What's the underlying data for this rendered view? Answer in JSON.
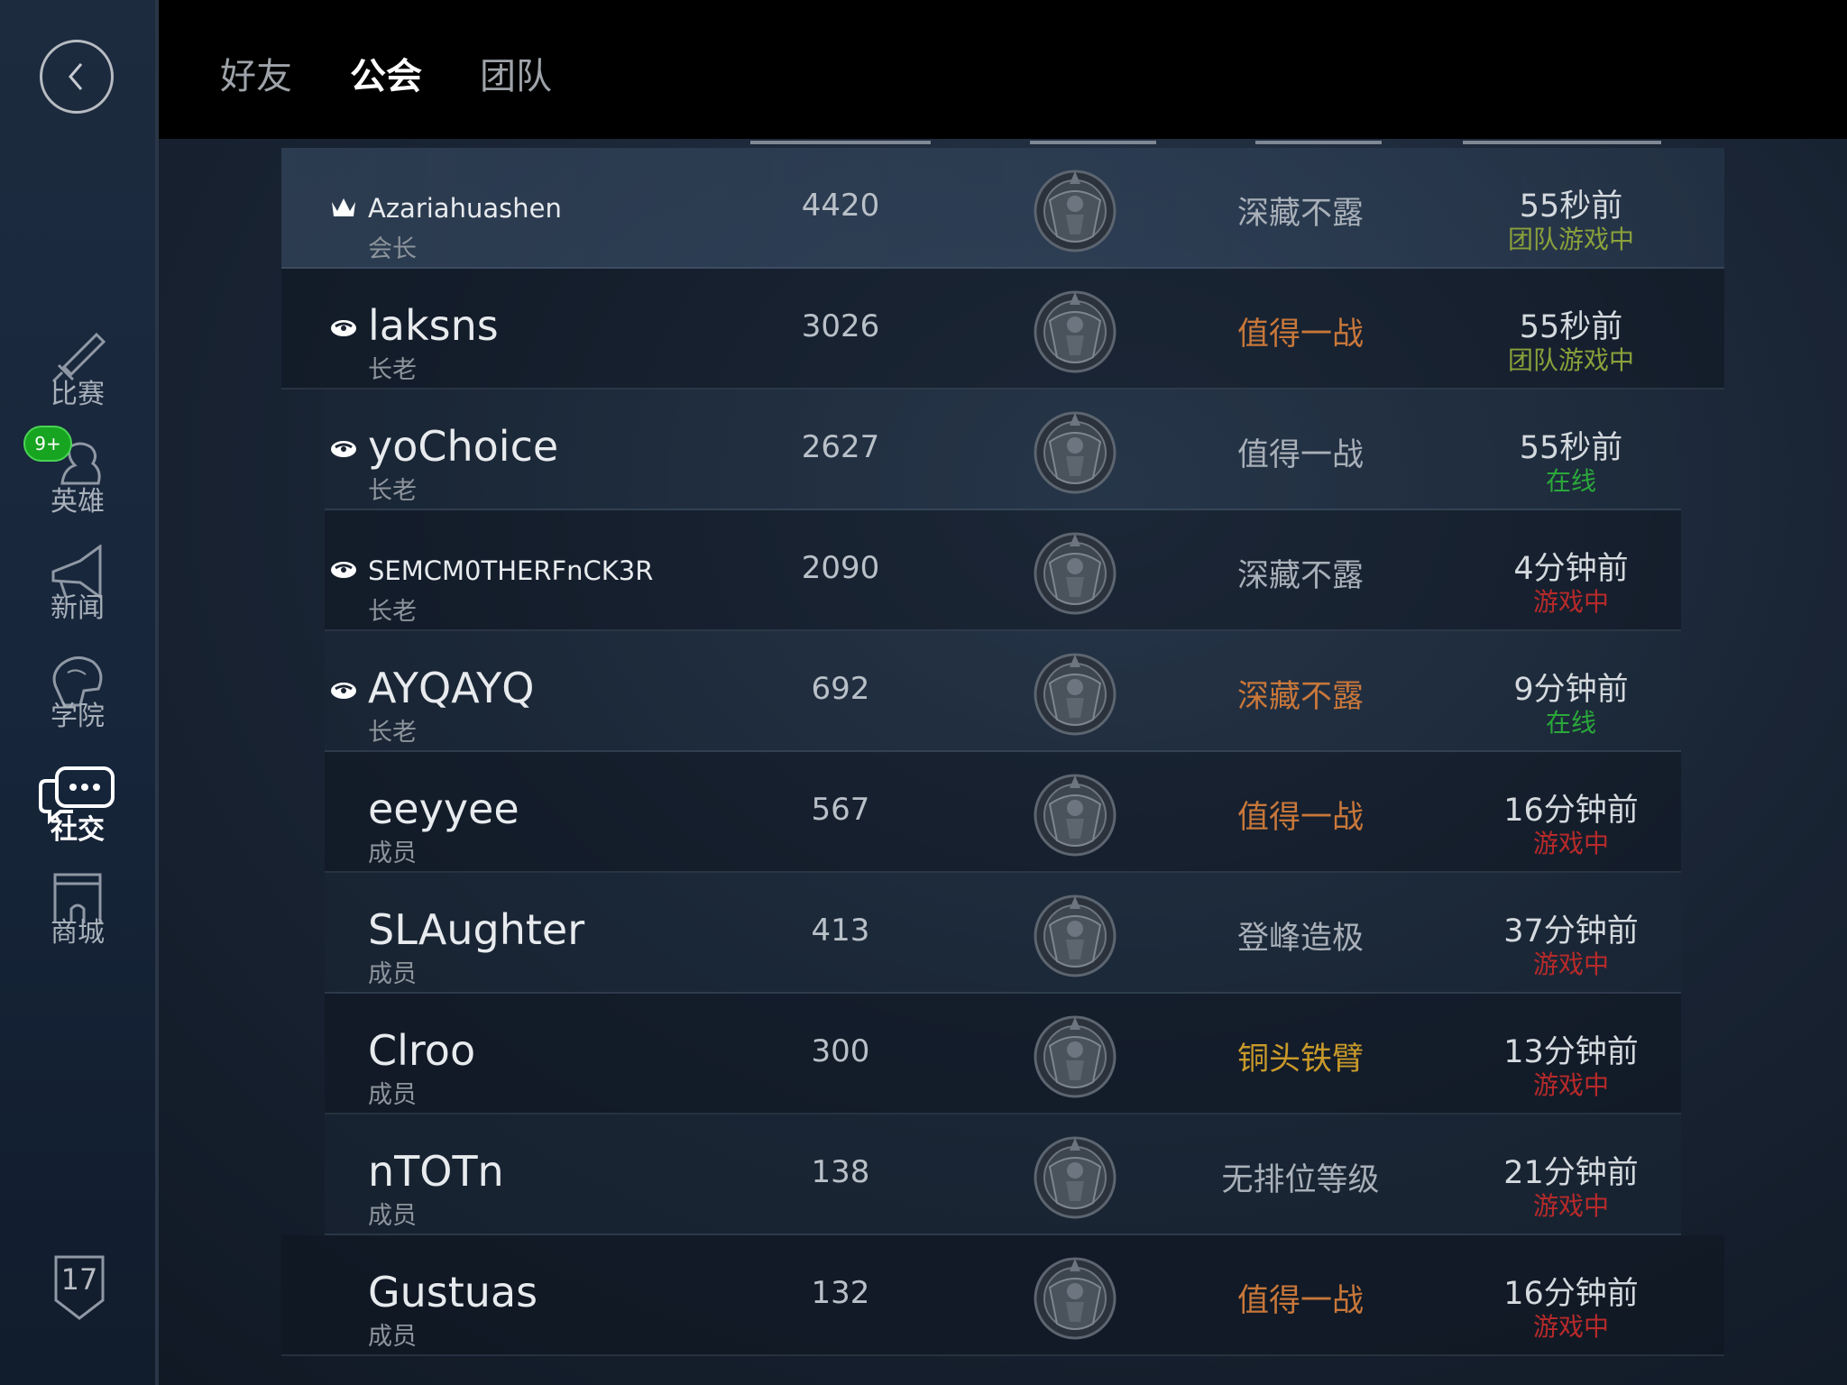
{
  "nav": {
    "items": [
      {
        "label": "比赛",
        "icon": "sword-icon"
      },
      {
        "label": "英雄",
        "icon": "hero-icon",
        "badge": "9+"
      },
      {
        "label": "新闻",
        "icon": "megaphone-icon"
      },
      {
        "label": "学院",
        "icon": "brain-icon"
      },
      {
        "label": "社交",
        "icon": "chat-icon",
        "active": true
      },
      {
        "label": "商城",
        "icon": "store-icon"
      }
    ],
    "level": "17"
  },
  "tabs": [
    {
      "label": "好友"
    },
    {
      "label": "公会",
      "active": true
    },
    {
      "label": "团队"
    }
  ],
  "members": [
    {
      "name": "Azariahuashen",
      "rank": "会长",
      "role_icon": "crown-icon",
      "score": "4420",
      "tier": "深藏不露",
      "tier_color": "#a8afb8",
      "time": "55秒前",
      "status": "团队游戏中",
      "status_color": "#8aa13a"
    },
    {
      "name": "laksns",
      "rank": "长老",
      "role_icon": "elder-icon",
      "score": "3026",
      "tier": "值得一战",
      "tier_color": "#c8773a",
      "time": "55秒前",
      "status": "团队游戏中",
      "status_color": "#8aa13a"
    },
    {
      "name": "yoChoice",
      "rank": "长老",
      "role_icon": "elder-icon",
      "score": "2627",
      "tier": "值得一战",
      "tier_color": "#a8afb8",
      "time": "55秒前",
      "status": "在线",
      "status_color": "#2aa83a"
    },
    {
      "name": "SEMCM0THERFnCK3R",
      "rank": "长老",
      "role_icon": "elder-icon",
      "score": "2090",
      "tier": "深藏不露",
      "tier_color": "#a8afb8",
      "time": "4分钟前",
      "status": "游戏中",
      "status_color": "#b82a2a"
    },
    {
      "name": "AYQAYQ",
      "rank": "长老",
      "role_icon": "elder-icon",
      "score": "692",
      "tier": "深藏不露",
      "tier_color": "#c8773a",
      "time": "9分钟前",
      "status": "在线",
      "status_color": "#2aa83a"
    },
    {
      "name": "eeyyee",
      "rank": "成员",
      "role_icon": "",
      "score": "567",
      "tier": "值得一战",
      "tier_color": "#c8773a",
      "time": "16分钟前",
      "status": "游戏中",
      "status_color": "#b82a2a"
    },
    {
      "name": "SLAughter",
      "rank": "成员",
      "role_icon": "",
      "score": "413",
      "tier": "登峰造极",
      "tier_color": "#a8afb8",
      "time": "37分钟前",
      "status": "游戏中",
      "status_color": "#b82a2a"
    },
    {
      "name": "Clroo",
      "rank": "成员",
      "role_icon": "",
      "score": "300",
      "tier": "铜头铁臂",
      "tier_color": "#c89a2a",
      "time": "13分钟前",
      "status": "游戏中",
      "status_color": "#b82a2a"
    },
    {
      "name": "nTOTn",
      "rank": "成员",
      "role_icon": "",
      "score": "138",
      "tier": "无排位等级",
      "tier_color": "#a8afb8",
      "time": "21分钟前",
      "status": "游戏中",
      "status_color": "#b82a2a"
    },
    {
      "name": "Gustuas",
      "rank": "成员",
      "role_icon": "",
      "score": "132",
      "tier": "值得一战",
      "tier_color": "#c8773a",
      "time": "16分钟前",
      "status": "游戏中",
      "status_color": "#b82a2a"
    }
  ]
}
